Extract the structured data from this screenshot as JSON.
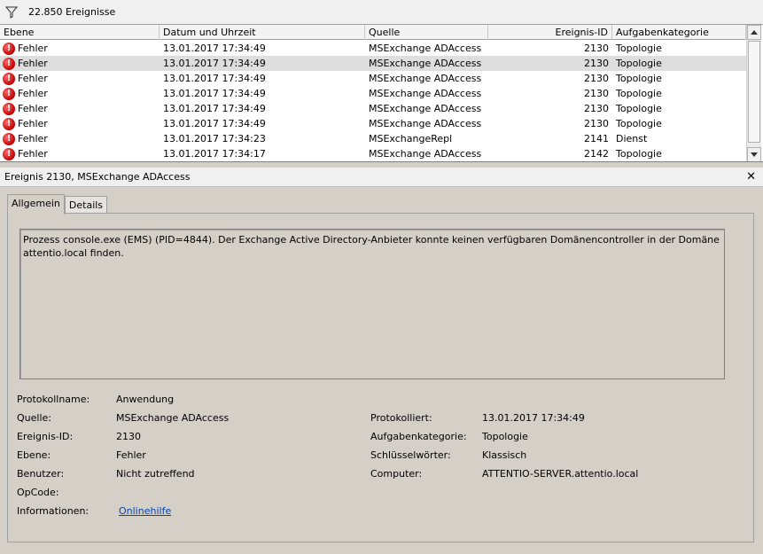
{
  "toolbar": {
    "event_count": "22.850 Ereignisse",
    "filter_icon": "filter-funnel-icon"
  },
  "grid": {
    "columns": [
      "Ebene",
      "Datum und Uhrzeit",
      "Quelle",
      "Ereignis-ID",
      "Aufgabenkategorie"
    ],
    "rows": [
      {
        "level": "Fehler",
        "date": "13.01.2017 17:34:49",
        "source": "MSExchange ADAccess",
        "id": "2130",
        "task": "Topologie"
      },
      {
        "level": "Fehler",
        "date": "13.01.2017 17:34:49",
        "source": "MSExchange ADAccess",
        "id": "2130",
        "task": "Topologie"
      },
      {
        "level": "Fehler",
        "date": "13.01.2017 17:34:49",
        "source": "MSExchange ADAccess",
        "id": "2130",
        "task": "Topologie"
      },
      {
        "level": "Fehler",
        "date": "13.01.2017 17:34:49",
        "source": "MSExchange ADAccess",
        "id": "2130",
        "task": "Topologie"
      },
      {
        "level": "Fehler",
        "date": "13.01.2017 17:34:49",
        "source": "MSExchange ADAccess",
        "id": "2130",
        "task": "Topologie"
      },
      {
        "level": "Fehler",
        "date": "13.01.2017 17:34:49",
        "source": "MSExchange ADAccess",
        "id": "2130",
        "task": "Topologie"
      },
      {
        "level": "Fehler",
        "date": "13.01.2017 17:34:23",
        "source": "MSExchangeRepl",
        "id": "2141",
        "task": "Dienst"
      },
      {
        "level": "Fehler",
        "date": "13.01.2017 17:34:17",
        "source": "MSExchange ADAccess",
        "id": "2142",
        "task": "Topologie"
      }
    ],
    "selected_index": 1
  },
  "detail": {
    "title": "Ereignis 2130, MSExchange ADAccess",
    "tabs": [
      "Allgemein",
      "Details"
    ],
    "description": "Prozess console.exe (EMS) (PID=4844). Der Exchange Active Directory-Anbieter konnte keinen verfügbaren Domänencontroller in der Domäne\nattentio.local finden.",
    "props": {
      "log_name_label": "Protokollname:",
      "log_name": "Anwendung",
      "source_label": "Quelle:",
      "source": "MSExchange ADAccess",
      "logged_label": "Protokolliert:",
      "logged": "13.01.2017 17:34:49",
      "event_id_label": "Ereignis-ID:",
      "event_id": "2130",
      "task_label": "Aufgabenkategorie:",
      "task": "Topologie",
      "level_label": "Ebene:",
      "level": "Fehler",
      "keywords_label": "Schlüsselwörter:",
      "keywords": "Klassisch",
      "user_label": "Benutzer:",
      "user": "Nicht zutreffend",
      "computer_label": "Computer:",
      "computer": "ATTENTIO-SERVER.attentio.local",
      "opcode_label": "OpCode:",
      "info_label": "Informationen:",
      "info_link": "Onlinehilfe"
    }
  }
}
